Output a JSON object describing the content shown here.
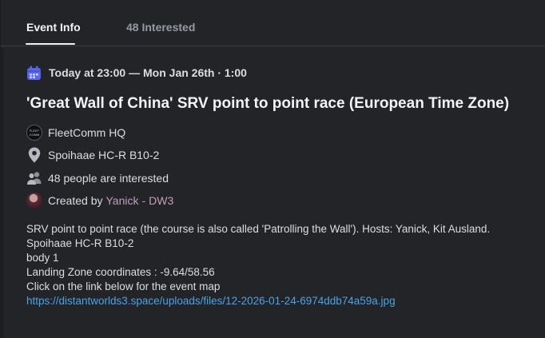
{
  "tabs": {
    "event_info": "Event Info",
    "interested": "48 Interested"
  },
  "event": {
    "date": "Today at 23:00 — Mon Jan 26th · 1:00",
    "title": "'Great Wall of China' SRV point to point race (European Time Zone)",
    "server": "FleetComm HQ",
    "server_avatar_text": [
      "FLEET",
      "COMM"
    ],
    "location": "Spoihaae HC-R B10-2",
    "interested_text": "48 people are interested",
    "created_by_prefix": "Created by",
    "creator_name": "Yanick",
    "creator_sep": "-",
    "creator_tag": "DW3"
  },
  "description": {
    "lines": [
      "SRV point to point race (the course is also called 'Patrolling the Wall'). Hosts: Yanick, Kit Ausland.",
      "Spoihaae HC-R B10-2",
      "body 1",
      "Landing Zone coordinates : -9.64/58.56",
      "Click on the link below for the event map"
    ],
    "link": "https://distantworlds3.space/uploads/files/12-2026-01-24-6974ddb74a59a.jpg"
  },
  "colors": {
    "background": "#232428",
    "accent_calendar": "#5865f2",
    "link": "#4aa3e8",
    "creator": "#c49dbd"
  },
  "icons": [
    "calendar-icon",
    "server-avatar",
    "location-pin-icon",
    "people-icon",
    "creator-avatar"
  ]
}
